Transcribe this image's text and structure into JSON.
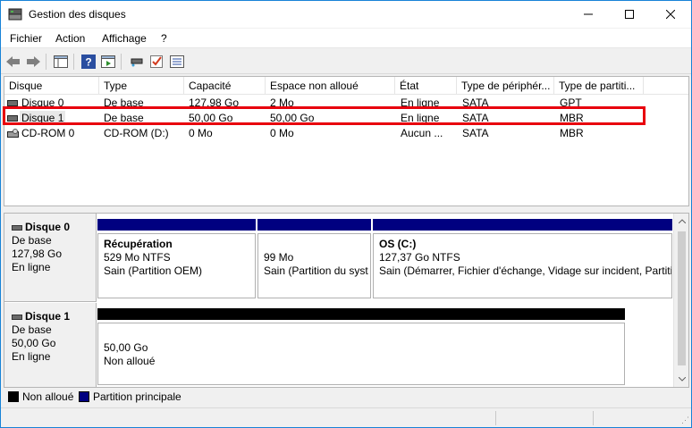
{
  "window": {
    "title": "Gestion des disques"
  },
  "menu": [
    "Fichier",
    "Action",
    "Affichage",
    "?"
  ],
  "colors": {
    "primary_partition": "#000080",
    "unallocated": "#000000",
    "highlight": "#e8000d",
    "window_border": "#1883d7"
  },
  "icons": {
    "app": "disk-management-icon",
    "back": "arrow-left-icon",
    "forward": "arrow-right-icon"
  },
  "volumes": {
    "columns": [
      "Disque",
      "Type",
      "Capacité",
      "Espace non alloué",
      "État",
      "Type de périphér...",
      "Type de partiti..."
    ],
    "rows": [
      {
        "disk": "Disque 0",
        "type": "De base",
        "capacity": "127,98 Go",
        "unallocated": "2 Mo",
        "state": "En ligne",
        "device": "SATA",
        "partition_type": "GPT"
      },
      {
        "disk": "Disque 1",
        "type": "De base",
        "capacity": "50,00 Go",
        "unallocated": "50,00 Go",
        "state": "En ligne",
        "device": "SATA",
        "partition_type": "MBR"
      },
      {
        "disk": "CD-ROM 0",
        "type": "CD-ROM (D:)",
        "capacity": "0 Mo",
        "unallocated": "0 Mo",
        "state": "Aucun ...",
        "device": "SATA",
        "partition_type": "MBR"
      }
    ]
  },
  "graph": {
    "disks": [
      {
        "name": "Disque 0",
        "type": "De base",
        "size": "127,98 Go",
        "state": "En ligne",
        "partitions": [
          {
            "title": "Récupération",
            "size": "529 Mo NTFS",
            "status": "Sain (Partition OEM)"
          },
          {
            "title": "",
            "size": "99 Mo",
            "status": "Sain (Partition du syst"
          },
          {
            "title": "OS  (C:)",
            "size": "127,37 Go NTFS",
            "status": "Sain (Démarrer, Fichier d'échange, Vidage sur incident, Partiti"
          }
        ]
      },
      {
        "name": "Disque 1",
        "type": "De base",
        "size": "50,00 Go",
        "state": "En ligne",
        "partitions": [
          {
            "title": "",
            "size": "50,00 Go",
            "status": "Non alloué"
          }
        ]
      }
    ]
  },
  "legend": {
    "unallocated": "Non alloué",
    "primary": "Partition principale"
  }
}
